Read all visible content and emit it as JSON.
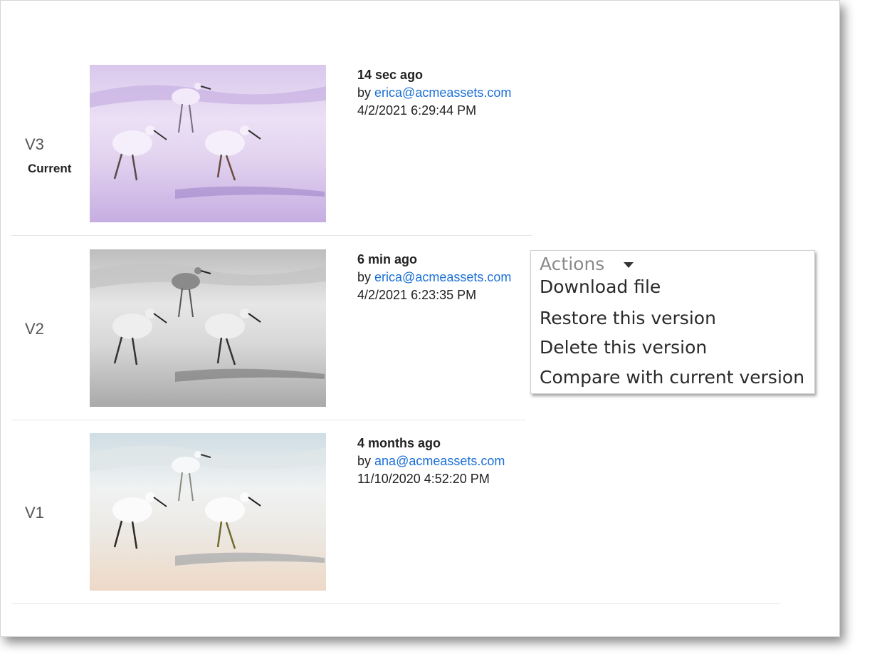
{
  "versions": [
    {
      "label": "V3",
      "badge": "Current",
      "ago": "14 sec ago",
      "by_prefix": "by",
      "author": "erica@acmeassets.com",
      "datetime": "4/2/2021 6:29:44 PM",
      "thumbnail_tint": "purple"
    },
    {
      "label": "V2",
      "ago": "6 min ago",
      "by_prefix": "by",
      "author": "erica@acmeassets.com",
      "datetime": "4/2/2021 6:23:35 PM",
      "thumbnail_tint": "grayscale"
    },
    {
      "label": "V1",
      "ago": "4 months ago",
      "by_prefix": "by",
      "author": "ana@acmeassets.com",
      "datetime": "11/10/2020 4:52:20 PM",
      "thumbnail_tint": "natural"
    }
  ],
  "actions_menu": {
    "header": "Actions",
    "header_icon": "caret-down-icon",
    "items": [
      "Download file",
      "Restore this version",
      "Delete this version",
      "Compare with current version"
    ]
  },
  "colors": {
    "link": "#1a6fd6",
    "text": "#222222",
    "muted": "#555555"
  }
}
